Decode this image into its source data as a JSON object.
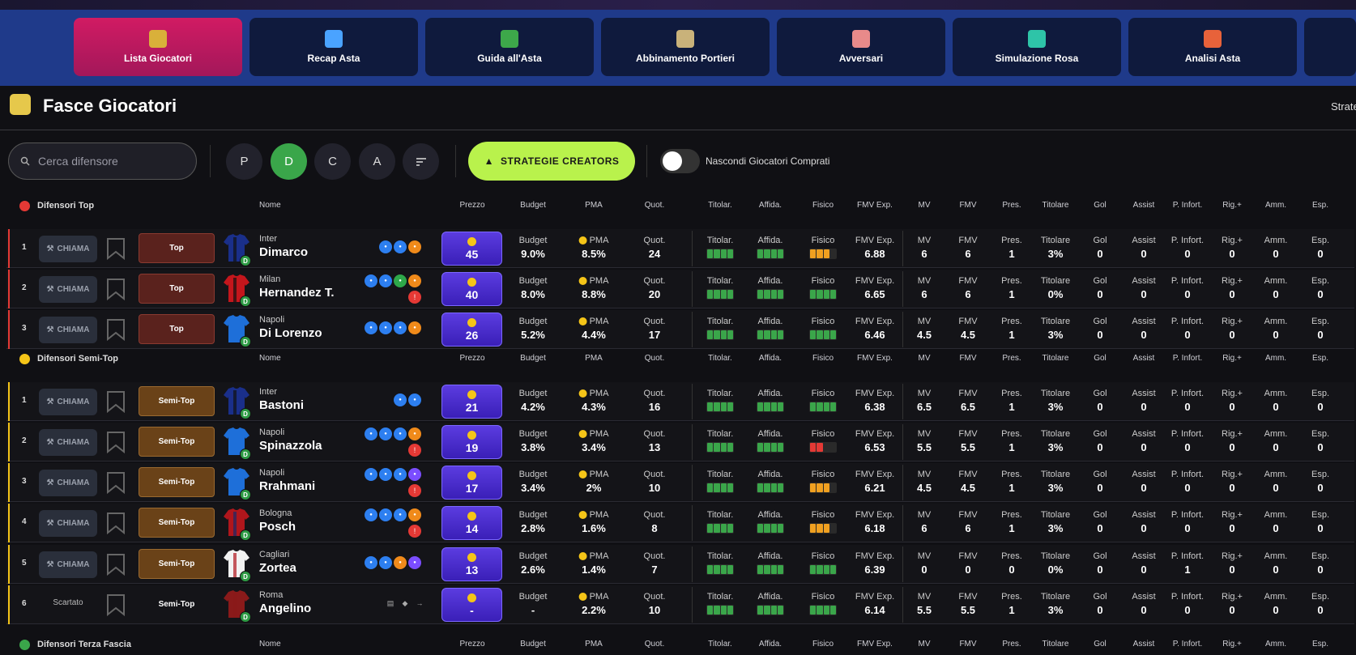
{
  "nav": [
    {
      "label": "Lista Giocatori",
      "color": "#d9b03a"
    },
    {
      "label": "Recap Asta",
      "color": "#4aa3ff"
    },
    {
      "label": "Guida all'Asta",
      "color": "#3da84a"
    },
    {
      "label": "Abbinamento Portieri",
      "color": "#c9b27a"
    },
    {
      "label": "Avversari",
      "color": "#e88a8a"
    },
    {
      "label": "Simulazione Rosa",
      "color": "#2ec4a8"
    },
    {
      "label": "Analisi Asta",
      "color": "#e8623a"
    }
  ],
  "header": {
    "title": "Fasce Giocatori",
    "right_text": "Strate"
  },
  "filters": {
    "search_placeholder": "Cerca difensore",
    "positions": [
      "P",
      "D",
      "C",
      "A"
    ],
    "creators_label": "STRATEGIE CREATORS",
    "toggle_label": "Nascondi Giocatori Comprati"
  },
  "columns": {
    "nome": "Nome",
    "prezzo": "Prezzo",
    "budget": "Budget",
    "pma": "PMA",
    "quot": "Quot.",
    "titolar": "Titolar.",
    "affida": "Affida.",
    "fisico": "Fisico",
    "fmvexp": "FMV Exp.",
    "mv": "MV",
    "fmv": "FMV",
    "pres": "Pres.",
    "titolare": "Titolare",
    "gol": "Gol",
    "assist": "Assist",
    "pinfort": "P. Infort.",
    "rig": "Rig.+",
    "amm": "Amm.",
    "esp": "Esp."
  },
  "call_label": "CHIAMA",
  "scartato_label": "Scartato",
  "sections": [
    {
      "name": "Difensori Top",
      "color": "#e53935",
      "rows": [
        {
          "idx": "1",
          "tier": "Top",
          "team": "Inter",
          "name": "Dimarco",
          "price": "45",
          "budget": "9.0%",
          "pma": "8.5%",
          "quot": "24",
          "fisico": "orange3",
          "fmvexp": "6.88",
          "mv": "6",
          "fmv": "6",
          "pres": "1",
          "titolare": "3%",
          "gol": "0",
          "assist": "0",
          "pinfort": "0",
          "rig": "0",
          "amm": "0",
          "esp": "0",
          "jersey": [
            "#1a2f8a",
            "#111"
          ],
          "badges": [
            "#2d7ff0",
            "#2d7ff0",
            "#f08a1a"
          ],
          "badges2": []
        },
        {
          "idx": "2",
          "tier": "Top",
          "team": "Milan",
          "name": "Hernandez T.",
          "price": "40",
          "budget": "8.0%",
          "pma": "8.8%",
          "quot": "20",
          "fisico": "green",
          "fmvexp": "6.65",
          "mv": "6",
          "fmv": "6",
          "pres": "1",
          "titolare": "0%",
          "gol": "0",
          "assist": "0",
          "pinfort": "0",
          "rig": "0",
          "amm": "0",
          "esp": "0",
          "jersey": [
            "#c4161c",
            "#111"
          ],
          "badges": [
            "#2d7ff0",
            "#2d7ff0",
            "#2ea84a",
            "#f08a1a"
          ],
          "badges2": [
            "#e53935"
          ]
        },
        {
          "idx": "3",
          "tier": "Top",
          "team": "Napoli",
          "name": "Di Lorenzo",
          "price": "26",
          "budget": "5.2%",
          "pma": "4.4%",
          "quot": "17",
          "fisico": "green",
          "fmvexp": "6.46",
          "mv": "4.5",
          "fmv": "4.5",
          "pres": "1",
          "titolare": "3%",
          "gol": "0",
          "assist": "0",
          "pinfort": "0",
          "rig": "0",
          "amm": "0",
          "esp": "0",
          "jersey": [
            "#1e6fd9",
            "#1e6fd9"
          ],
          "badges": [
            "#2d7ff0",
            "#2d7ff0",
            "#2d7ff0",
            "#f08a1a"
          ],
          "badges2": []
        }
      ]
    },
    {
      "name": "Difensori Semi-Top",
      "color": "#f5c518",
      "rows": [
        {
          "idx": "1",
          "tier": "Semi-Top",
          "team": "Inter",
          "name": "Bastoni",
          "price": "21",
          "budget": "4.2%",
          "pma": "4.3%",
          "quot": "16",
          "fisico": "green",
          "fmvexp": "6.38",
          "mv": "6.5",
          "fmv": "6.5",
          "pres": "1",
          "titolare": "3%",
          "gol": "0",
          "assist": "0",
          "pinfort": "0",
          "rig": "0",
          "amm": "0",
          "esp": "0",
          "jersey": [
            "#1a2f8a",
            "#111"
          ],
          "badges": [
            "#2d7ff0",
            "#2d7ff0"
          ],
          "badges2": []
        },
        {
          "idx": "2",
          "tier": "Semi-Top",
          "team": "Napoli",
          "name": "Spinazzola",
          "price": "19",
          "budget": "3.8%",
          "pma": "3.4%",
          "quot": "13",
          "fisico": "red",
          "fmvexp": "6.53",
          "mv": "5.5",
          "fmv": "5.5",
          "pres": "1",
          "titolare": "3%",
          "gol": "0",
          "assist": "0",
          "pinfort": "0",
          "rig": "0",
          "amm": "0",
          "esp": "0",
          "jersey": [
            "#1e6fd9",
            "#1e6fd9"
          ],
          "badges": [
            "#2d7ff0",
            "#2d7ff0",
            "#2d7ff0",
            "#f08a1a"
          ],
          "badges2": [
            "#e53935"
          ]
        },
        {
          "idx": "3",
          "tier": "Semi-Top",
          "team": "Napoli",
          "name": "Rrahmani",
          "price": "17",
          "budget": "3.4%",
          "pma": "2%",
          "quot": "10",
          "fisico": "orange3",
          "fmvexp": "6.21",
          "mv": "4.5",
          "fmv": "4.5",
          "pres": "1",
          "titolare": "3%",
          "gol": "0",
          "assist": "0",
          "pinfort": "0",
          "rig": "0",
          "amm": "0",
          "esp": "0",
          "jersey": [
            "#1e6fd9",
            "#1e6fd9"
          ],
          "badges": [
            "#2d7ff0",
            "#2d7ff0",
            "#2d7ff0",
            "#7b4dff"
          ],
          "badges2": [
            "#e53935"
          ]
        },
        {
          "idx": "4",
          "tier": "Semi-Top",
          "team": "Bologna",
          "name": "Posch",
          "price": "14",
          "budget": "2.8%",
          "pma": "1.6%",
          "quot": "8",
          "fisico": "orange3",
          "fmvexp": "6.18",
          "mv": "6",
          "fmv": "6",
          "pres": "1",
          "titolare": "3%",
          "gol": "0",
          "assist": "0",
          "pinfort": "0",
          "rig": "0",
          "amm": "0",
          "esp": "0",
          "jersey": [
            "#b0161c",
            "#1a2a6a"
          ],
          "badges": [
            "#2d7ff0",
            "#2d7ff0",
            "#2d7ff0",
            "#f08a1a"
          ],
          "badges2": [
            "#e53935"
          ]
        },
        {
          "idx": "5",
          "tier": "Semi-Top",
          "team": "Cagliari",
          "name": "Zortea",
          "price": "13",
          "budget": "2.6%",
          "pma": "1.4%",
          "quot": "7",
          "fisico": "green",
          "fmvexp": "6.39",
          "mv": "0",
          "fmv": "0",
          "pres": "0",
          "titolare": "0%",
          "gol": "0",
          "assist": "0",
          "pinfort": "1",
          "rig": "0",
          "amm": "0",
          "esp": "0",
          "jersey": [
            "#f2f2f2",
            "#b0161c"
          ],
          "badges": [
            "#2d7ff0",
            "#2d7ff0",
            "#f08a1a",
            "#7b4dff"
          ],
          "badges2": []
        },
        {
          "idx": "6",
          "tier": "Semi-Top",
          "team": "Roma",
          "name": "Angelino",
          "price": "-",
          "budget": "-",
          "pma": "2.2%",
          "quot": "10",
          "fisico": "green",
          "fmvexp": "6.14",
          "mv": "5.5",
          "fmv": "5.5",
          "pres": "1",
          "titolare": "3%",
          "gol": "0",
          "assist": "0",
          "pinfort": "0",
          "rig": "0",
          "amm": "0",
          "esp": "0",
          "jersey": [
            "#8a1a1a",
            "#8a1a1a"
          ],
          "badges": [],
          "badges2": [],
          "scartato": true
        }
      ]
    },
    {
      "name": "Difensori Terza Fascia",
      "color": "#3aa64a",
      "rows": []
    }
  ]
}
